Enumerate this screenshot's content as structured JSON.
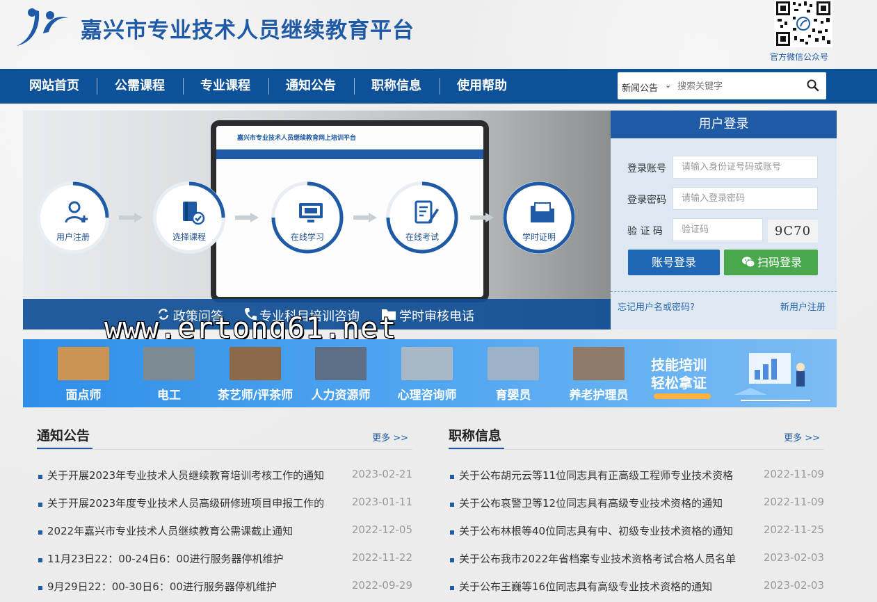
{
  "header": {
    "site_title": "嘉兴市专业技术人员继续教育平台",
    "qr_label": "官方微信公众号"
  },
  "nav": {
    "items": [
      {
        "label": "网站首页"
      },
      {
        "label": "公需课程"
      },
      {
        "label": "专业课程"
      },
      {
        "label": "通知公告"
      },
      {
        "label": "职称信息"
      },
      {
        "label": "使用帮助"
      }
    ],
    "search": {
      "category": "新闻公告",
      "placeholder": "搜索关键字"
    }
  },
  "banner": {
    "screen_title": "嘉兴市专业技术人员继续教育网上培训平台",
    "steps": [
      {
        "label": "用户注册",
        "icon": "user-add-icon"
      },
      {
        "label": "选择课程",
        "icon": "book-check-icon"
      },
      {
        "label": "在线学习",
        "icon": "monitor-icon"
      },
      {
        "label": "在线考试",
        "icon": "exam-pen-icon"
      },
      {
        "label": "学时证明",
        "icon": "folder-icon"
      }
    ],
    "bottom_links": [
      {
        "label": "政策问答",
        "icon": "refresh-icon"
      },
      {
        "label": "专业科目培训咨询",
        "icon": "phone-icon"
      },
      {
        "label": "学时审核电话",
        "icon": "folder-icon"
      }
    ]
  },
  "watermark": "www.ertong61.net",
  "login": {
    "title": "用户登录",
    "account_label": "登录账号",
    "account_placeholder": "请输入身份证号码或账号",
    "password_label": "登录密码",
    "password_placeholder": "请输入登录密码",
    "captcha_label": "验 证 码",
    "captcha_placeholder": "验证码",
    "captcha_text": "9C70",
    "account_button": "账号登录",
    "scan_button": "扫码登录",
    "forgot_link": "忘记用户名或密码?",
    "register_link": "新用户注册"
  },
  "categories": {
    "items": [
      {
        "label": "面点师",
        "color": "#c99454"
      },
      {
        "label": "电工",
        "color": "#7c8a94"
      },
      {
        "label": "茶艺师/评茶师",
        "color": "#8a6a4a"
      },
      {
        "label": "人力资源师",
        "color": "#5d6f86"
      },
      {
        "label": "心理咨询师",
        "color": "#a9b8c7"
      },
      {
        "label": "育婴员",
        "color": "#9bb2c9"
      },
      {
        "label": "养老护理员",
        "color": "#8f7b67"
      }
    ],
    "promo_line1": "技能培训",
    "promo_line2": "轻松拿证"
  },
  "notices": {
    "title": "通知公告",
    "more": "更多 >>",
    "rows": [
      {
        "text": "关于开展2023年专业技术人员继续教育培训考核工作的通知",
        "date": "2023-02-21"
      },
      {
        "text": "关于开展2023年度专业技术人员高级研修班项目申报工作的",
        "date": "2023-01-11"
      },
      {
        "text": "2022年嘉兴市专业技术人员继续教育公需课截止通知",
        "date": "2022-12-05"
      },
      {
        "text": "11月23日22：00-24日6：00进行服务器停机维护",
        "date": "2022-11-22"
      },
      {
        "text": "9月29日22：00-30日6：00进行服务器停机维护",
        "date": "2022-09-29"
      }
    ]
  },
  "titles": {
    "title": "职称信息",
    "more": "更多 >>",
    "rows": [
      {
        "text": "关于公布胡元云等11位同志具有正高级工程师专业技术资格",
        "date": "2022-11-09"
      },
      {
        "text": "关于公布哀警卫等12位同志具有高级专业技术资格的通知",
        "date": "2022-11-09"
      },
      {
        "text": "关于公布林根等40位同志具有中、初级专业技术资格的通知",
        "date": "2022-11-25"
      },
      {
        "text": "关于公布我市2022年省档案专业技术资格考试合格人员名单",
        "date": "2023-02-03"
      },
      {
        "text": "关于公布王巍等16位同志具有高级专业技术资格的通知",
        "date": "2023-02-03"
      }
    ]
  },
  "colors": {
    "primary": "#0d5199",
    "accent_blue": "#1f66b4",
    "accent_green": "#4aa84c"
  }
}
